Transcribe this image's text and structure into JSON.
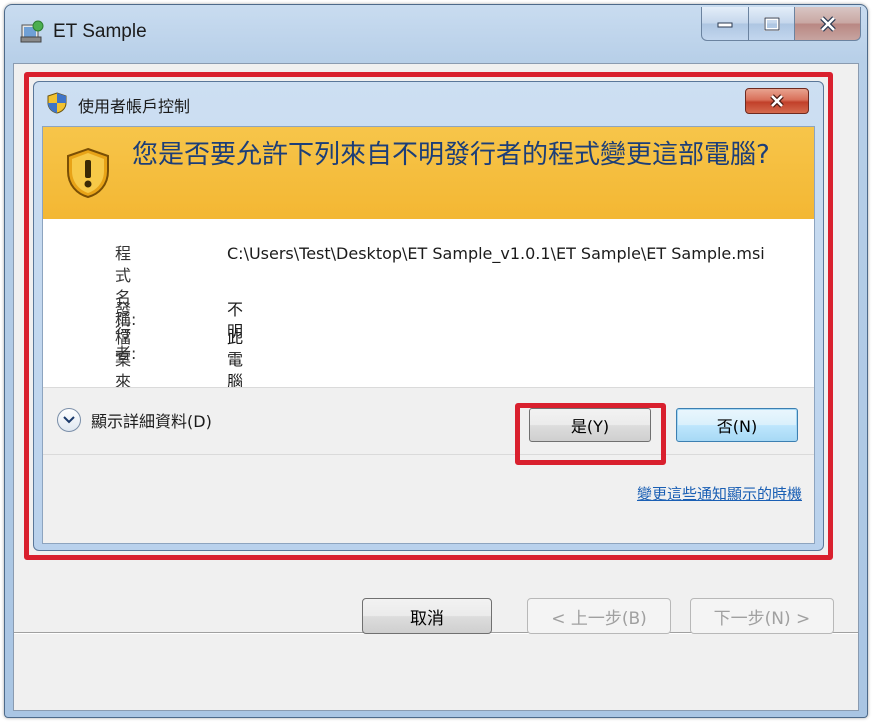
{
  "outer_window": {
    "title": "ET Sample",
    "buttons": {
      "cancel": "取消",
      "back": "< 上一步(B)",
      "next": "下一步(N) >"
    }
  },
  "uac": {
    "title": "使用者帳戶控制",
    "question": "您是否要允許下列來自不明發行者的程式變更這部電腦?",
    "program_label": "程式名稱:",
    "program_value": "C:\\Users\\Test\\Desktop\\ET Sample_v1.0.1\\ET Sample\\ET Sample.msi",
    "publisher_label": "發行者:",
    "publisher_value": "不明",
    "source_label": "檔案來源:",
    "source_value": "此電腦上的硬碟",
    "details_label": "顯示詳細資料(D)",
    "yes_label": "是(Y)",
    "no_label": "否(N)",
    "notify_link": "變更這些通知顯示的時機"
  },
  "colors": {
    "highlight": "#d9202e",
    "banner": "#f3b733",
    "question_text": "#1c3e78",
    "link": "#1a5fb4"
  },
  "icons": [
    "installer-icon",
    "minimize-icon",
    "maximize-icon",
    "close-icon",
    "uac-shield-icon",
    "warning-shield-icon",
    "chevron-down-icon"
  ]
}
